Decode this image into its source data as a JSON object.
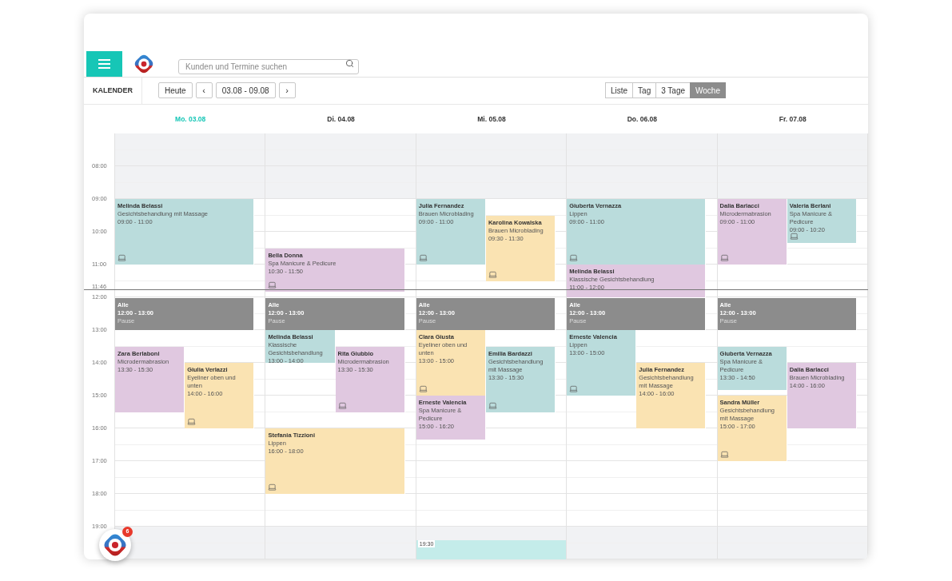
{
  "search": {
    "placeholder": "Kunden und Termine suchen"
  },
  "toolbar": {
    "section": "KALENDER",
    "today_button": "Heute",
    "prev": "‹",
    "range": "03.08 - 09.08",
    "next": "›"
  },
  "views": [
    {
      "label": "Liste",
      "selected": false
    },
    {
      "label": "Tag",
      "selected": false
    },
    {
      "label": "3 Tage",
      "selected": false
    },
    {
      "label": "Woche",
      "selected": true
    }
  ],
  "hours": [
    "08:00",
    "09:00",
    "10:00",
    "11:00",
    "12:00",
    "13:00",
    "14:00",
    "15:00",
    "16:00",
    "17:00",
    "18:00",
    "19:00"
  ],
  "now": "11:46",
  "days": [
    {
      "label": "Mo. 03.08",
      "today": true,
      "events": [
        {
          "kind": "appointment",
          "name": "Melinda Belassi",
          "service": "Gesichtsbehandlung mit Massage",
          "time": "09:00 - 11:00",
          "color": "#badcdc",
          "device": true
        },
        {
          "kind": "pause",
          "name": "Alle",
          "time": "12:00 - 13:00",
          "service": "Pause",
          "color": "#8c8c8c",
          "device": false
        },
        {
          "kind": "appointment",
          "name": "Zara Berlaboni",
          "service": "Microdermabrasion",
          "time": "13:30 - 15:30",
          "color": "#e0c8e0",
          "device": false
        },
        {
          "kind": "appointment",
          "name": "Giulia Verlazzi",
          "service": "Eyeliner oben und unten",
          "time": "14:00 - 16:00",
          "color": "#fae3b2",
          "device": true
        }
      ]
    },
    {
      "label": "Di. 04.08",
      "today": false,
      "events": [
        {
          "kind": "appointment",
          "name": "Bella Donna",
          "service": "Spa Manicure & Pedicure",
          "time": "10:30 - 11:50",
          "color": "#e0c8e0",
          "device": true
        },
        {
          "kind": "pause",
          "name": "Alle",
          "time": "12:00 - 13:00",
          "service": "Pause",
          "color": "#8c8c8c",
          "device": false
        },
        {
          "kind": "appointment",
          "name": "Melinda Belassi",
          "service": "Klassische Gesichtsbehandlung",
          "time": "13:00 - 14:00",
          "color": "#badcdc",
          "device": false
        },
        {
          "kind": "appointment",
          "name": "Rita Giubbio",
          "service": "Microdermabrasion",
          "time": "13:30 - 15:30",
          "color": "#e0c8e0",
          "device": true
        },
        {
          "kind": "appointment",
          "name": "Stefania Tizzioni",
          "service": "Lippen",
          "time": "16:00 - 18:00",
          "color": "#fae3b2",
          "device": true
        }
      ]
    },
    {
      "label": "Mi. 05.08",
      "today": false,
      "events": [
        {
          "kind": "appointment",
          "name": "Julia Fernandez",
          "service": "Brauen Microblading",
          "time": "09:00 - 11:00",
          "color": "#badcdc",
          "device": true
        },
        {
          "kind": "appointment",
          "name": "Karolina Kowalska",
          "service": "Brauen Microblading",
          "time": "09:30 - 11:30",
          "color": "#fae3b2",
          "device": true
        },
        {
          "kind": "pause",
          "name": "Alle",
          "time": "12:00 - 13:00",
          "service": "Pause",
          "color": "#8c8c8c",
          "device": false
        },
        {
          "kind": "appointment",
          "name": "Clara Giusta",
          "service": "Eyeliner oben und unten",
          "time": "13:00 - 15:00",
          "color": "#fae3b2",
          "device": true
        },
        {
          "kind": "appointment",
          "name": "Emilia Bardazzi",
          "service": "Gesichtsbehandlung mit Massage",
          "time": "13:30 - 15:30",
          "color": "#badcdc",
          "device": true
        },
        {
          "kind": "appointment",
          "name": "Erneste Valencia",
          "service": "Spa Manicure & Pedicure",
          "time": "15:00 - 16:20",
          "color": "#e0c8e0",
          "device": false
        },
        {
          "kind": "start",
          "time": "19:30",
          "color": "#c4ecea"
        }
      ]
    },
    {
      "label": "Do. 06.08",
      "today": false,
      "events": [
        {
          "kind": "appointment",
          "name": "Giuberta Vernazza",
          "service": "Lippen",
          "time": "09:00 - 11:00",
          "color": "#badcdc",
          "device": true
        },
        {
          "kind": "appointment",
          "name": "Melinda Belassi",
          "service": "Klassische Gesichtsbehandlung",
          "time": "11:00 - 12:00",
          "color": "#e0c8e0",
          "device": false
        },
        {
          "kind": "pause",
          "name": "Alle",
          "time": "12:00 - 13:00",
          "service": "Pause",
          "color": "#8c8c8c",
          "device": false
        },
        {
          "kind": "appointment",
          "name": "Erneste Valencia",
          "service": "Lippen",
          "time": "13:00 - 15:00",
          "color": "#badcdc",
          "device": true
        },
        {
          "kind": "appointment",
          "name": "Julia Fernandez",
          "service": "Gesichtsbehandlung mit Massage",
          "time": "14:00 - 16:00",
          "color": "#fae3b2",
          "device": false
        }
      ]
    },
    {
      "label": "Fr. 07.08",
      "today": false,
      "events": [
        {
          "kind": "appointment",
          "name": "Dalia Barlacci",
          "service": "Microdermabrasion",
          "time": "09:00 - 11:00",
          "color": "#e0c8e0",
          "device": true
        },
        {
          "kind": "appointment",
          "name": "Valeria Berlani",
          "service": "Spa Manicure & Pedicure",
          "time": "09:00 - 10:20",
          "color": "#badcdc",
          "device": true
        },
        {
          "kind": "pause",
          "name": "Alle",
          "time": "12:00 - 13:00",
          "service": "Pause",
          "color": "#8c8c8c",
          "device": false
        },
        {
          "kind": "appointment",
          "name": "Giuberta Vernazza",
          "service": "Spa Manicure & Pedicure",
          "time": "13:30 - 14:50",
          "color": "#badcdc",
          "device": false
        },
        {
          "kind": "appointment",
          "name": "Dalia Barlacci",
          "service": "Brauen Microblading",
          "time": "14:00 - 16:00",
          "color": "#e0c8e0",
          "device": false
        },
        {
          "kind": "appointment",
          "name": "Sandra Müller",
          "service": "Gesichtsbehandlung mit Massage",
          "time": "15:00 - 17:00",
          "color": "#fae3b2",
          "device": true
        }
      ]
    }
  ],
  "notifications": {
    "badge": "6"
  }
}
